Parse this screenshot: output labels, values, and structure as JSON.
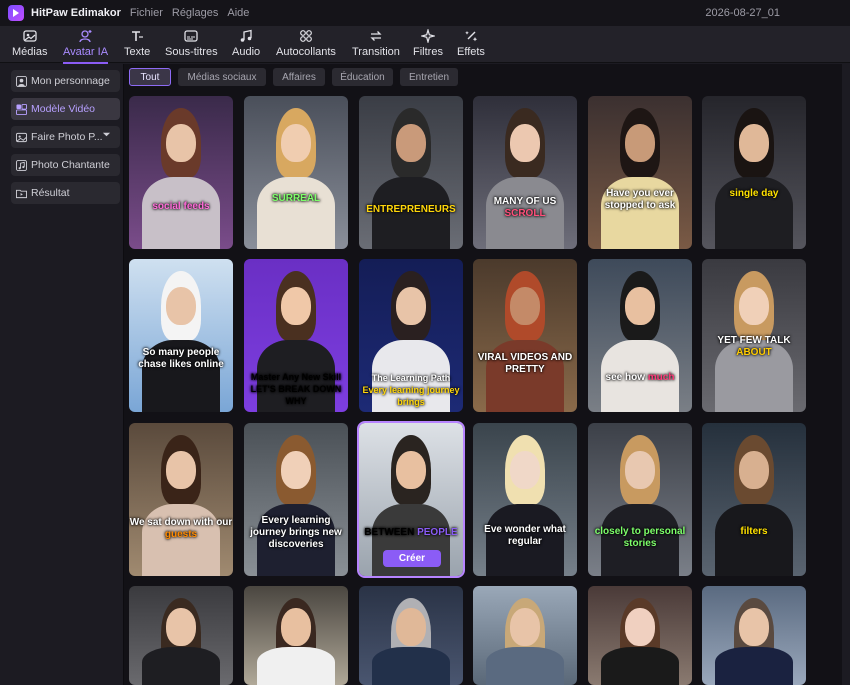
{
  "app": {
    "name": "HitPaw Edimakor",
    "menus": [
      "Fichier",
      "Réglages",
      "Aide"
    ],
    "date": "2026-08-27_01"
  },
  "toolbar": [
    {
      "label": "Médias",
      "icon": "image-icon"
    },
    {
      "label": "Avatar IA",
      "icon": "avatar-icon",
      "active": true
    },
    {
      "label": "Texte",
      "icon": "text-icon"
    },
    {
      "label": "Sous-titres",
      "icon": "subtitle-icon"
    },
    {
      "label": "Audio",
      "icon": "music-icon"
    },
    {
      "label": "Autocollants",
      "icon": "sticker-icon"
    },
    {
      "label": "Transition",
      "icon": "transition-icon"
    },
    {
      "label": "Filtres",
      "icon": "filter-icon"
    },
    {
      "label": "Effets",
      "icon": "effects-icon"
    }
  ],
  "sidebar": [
    {
      "label": "Mon personnage",
      "icon": "person-icon"
    },
    {
      "label": "Modèle Vidéo",
      "icon": "template-icon",
      "active": true
    },
    {
      "label": "Faire Photo P...",
      "icon": "photo-icon",
      "dropdown": true
    },
    {
      "label": "Photo Chantante",
      "icon": "singing-photo-icon"
    },
    {
      "label": "Résultat",
      "icon": "folder-icon"
    }
  ],
  "filters": [
    "Tout",
    "Médias sociaux",
    "Affaires",
    "Éducation",
    "Entretien"
  ],
  "create_label": "Créer",
  "accent": "#8b5cf6",
  "cards": [
    {
      "caption": "social feeds",
      "hi": ""
    },
    {
      "caption": "SURREAL",
      "hi": ""
    },
    {
      "caption": "ENTREPRENEURS",
      "hi": ""
    },
    {
      "caption": "MANY OF US",
      "hi": "SCROLL"
    },
    {
      "caption": "Have you ever stopped to ask",
      "hi": ""
    },
    {
      "caption": "single day",
      "hi": ""
    },
    {
      "caption": "So many people chase likes online",
      "hi": ""
    },
    {
      "caption": "Master Any New Skill",
      "hi": "LET'S BREAK DOWN WHY"
    },
    {
      "caption": "The Learning Path",
      "hi": "Every learning journey brings"
    },
    {
      "caption": "VIRAL VIDEOS AND PRETTY",
      "hi": ""
    },
    {
      "caption": "see how",
      "hi": "much"
    },
    {
      "caption": "YET FEW TALK",
      "hi": "ABOUT"
    },
    {
      "caption": "We sat down with our",
      "hi": "guests"
    },
    {
      "caption": "Every learning journey brings new discoveries",
      "hi": ""
    },
    {
      "caption": "BETWEEN",
      "hi": "PEOPLE"
    },
    {
      "caption": "Eve wonder what regular",
      "hi": ""
    },
    {
      "caption": "closely to personal stories",
      "hi": ""
    },
    {
      "caption": "filters",
      "hi": ""
    },
    {
      "caption": "",
      "hi": ""
    },
    {
      "caption": "",
      "hi": ""
    },
    {
      "caption": "",
      "hi": ""
    },
    {
      "caption": "",
      "hi": ""
    },
    {
      "caption": "",
      "hi": ""
    },
    {
      "caption": "",
      "hi": ""
    }
  ]
}
